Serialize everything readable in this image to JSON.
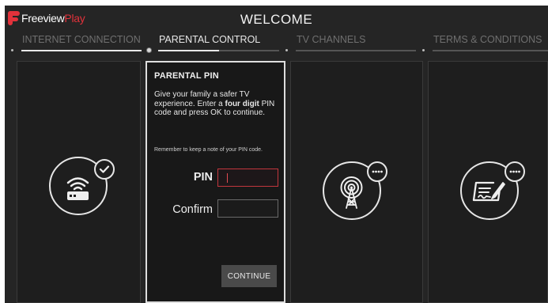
{
  "logo": {
    "word1": "Freeview",
    "word2": "Play"
  },
  "header": {
    "title": "WELCOME"
  },
  "steps": [
    {
      "label": "INTERNET CONNECTION",
      "active": false
    },
    {
      "label": "PARENTAL CONTROL",
      "active": true,
      "progress": 0.5
    },
    {
      "label": "TV CHANNELS",
      "active": false
    },
    {
      "label": "TERMS & CONDITIONS",
      "active": false
    }
  ],
  "parental_pin": {
    "title": "PARENTAL PIN",
    "desc_before": "Give your family a safer TV experience. Enter a ",
    "desc_bold": "four digit",
    "desc_after": " PIN code and press OK to continue.",
    "note": "Remember to keep a note of your PIN code.",
    "pin_label": "PIN",
    "pin_value": "",
    "confirm_label": "Confirm",
    "confirm_value": "",
    "continue_label": "CONTINUE"
  },
  "icons": {
    "internet": "wifi-router-icon",
    "internet_badge": "checkmark-icon",
    "channels": "broadcast-tower-icon",
    "channels_badge": "more-dots-icon",
    "terms": "signed-document-icon",
    "terms_badge": "more-dots-icon"
  },
  "colors": {
    "accent": "#e2323b",
    "background": "#252525",
    "focus": "#c2363d"
  }
}
